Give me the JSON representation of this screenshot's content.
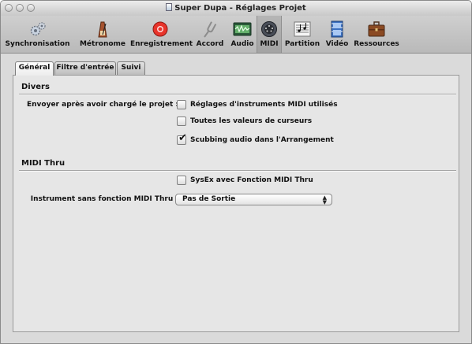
{
  "window": {
    "title": "Super Dupa - Réglages Projet"
  },
  "toolbar": {
    "items": [
      {
        "label": "Synchronisation",
        "icon": "gears-icon"
      },
      {
        "label": "Métronome",
        "icon": "metronome-icon"
      },
      {
        "label": "Enregistrement",
        "icon": "record-icon"
      },
      {
        "label": "Accord",
        "icon": "tuning-fork-icon"
      },
      {
        "label": "Audio",
        "icon": "audio-icon"
      },
      {
        "label": "MIDI",
        "icon": "midi-icon"
      },
      {
        "label": "Partition",
        "icon": "score-icon"
      },
      {
        "label": "Vidéo",
        "icon": "video-icon"
      },
      {
        "label": "Ressources",
        "icon": "briefcase-icon"
      }
    ],
    "selected": "MIDI"
  },
  "tabs": [
    {
      "label": "Général"
    },
    {
      "label": "Filtre d'entrée"
    },
    {
      "label": "Suivi"
    }
  ],
  "active_tab": "Général",
  "divers": {
    "title": "Divers",
    "send_label": "Envoyer après avoir chargé le projet :",
    "options": [
      {
        "label": "Réglages d'instruments MIDI utilisés",
        "checked": false
      },
      {
        "label": "Toutes les valeurs de curseurs",
        "checked": false
      },
      {
        "label": "Scubbing audio dans l'Arrangement",
        "checked": true
      }
    ]
  },
  "midi_thru": {
    "title": "MIDI Thru",
    "sysex": {
      "label": "SysEx avec Fonction  MIDI Thru",
      "checked": false
    },
    "instrument_label": "Instrument sans fonction MIDI Thru :",
    "instrument_value": "Pas de Sortie"
  },
  "colors": {
    "record": "#e8342b",
    "accent_blue": "#3a6fc0"
  }
}
